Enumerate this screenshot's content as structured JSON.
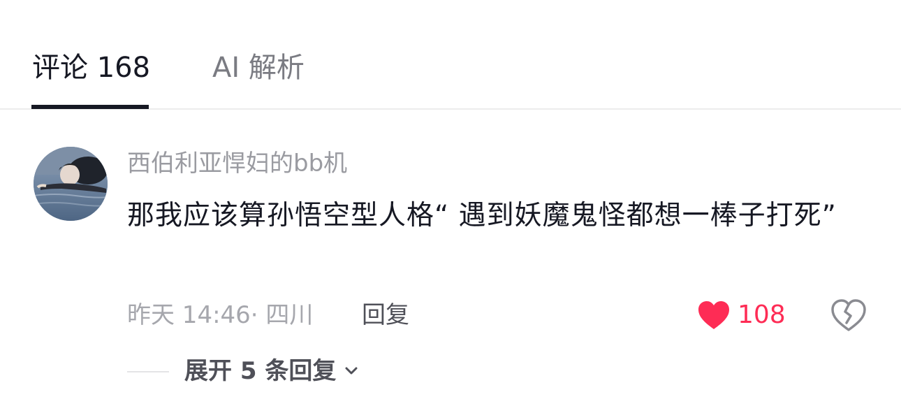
{
  "tabs": {
    "comments_label": "评论 168",
    "ai_label": "AI 解析"
  },
  "comment": {
    "username": "西伯利亚悍妇的bb机",
    "text": "那我应该算孙悟空型人格“ 遇到妖魔鬼怪都想一棒子打死”",
    "meta": "昨天 14:46· 四川",
    "reply_label": "回复",
    "like_count": "108",
    "liked": true,
    "like_color": "#fe2c55",
    "expand_label": "展开 5 条回复"
  },
  "icons": {
    "like": "heart-icon",
    "dislike": "broken-heart-icon",
    "expand": "chevron-down-icon"
  }
}
